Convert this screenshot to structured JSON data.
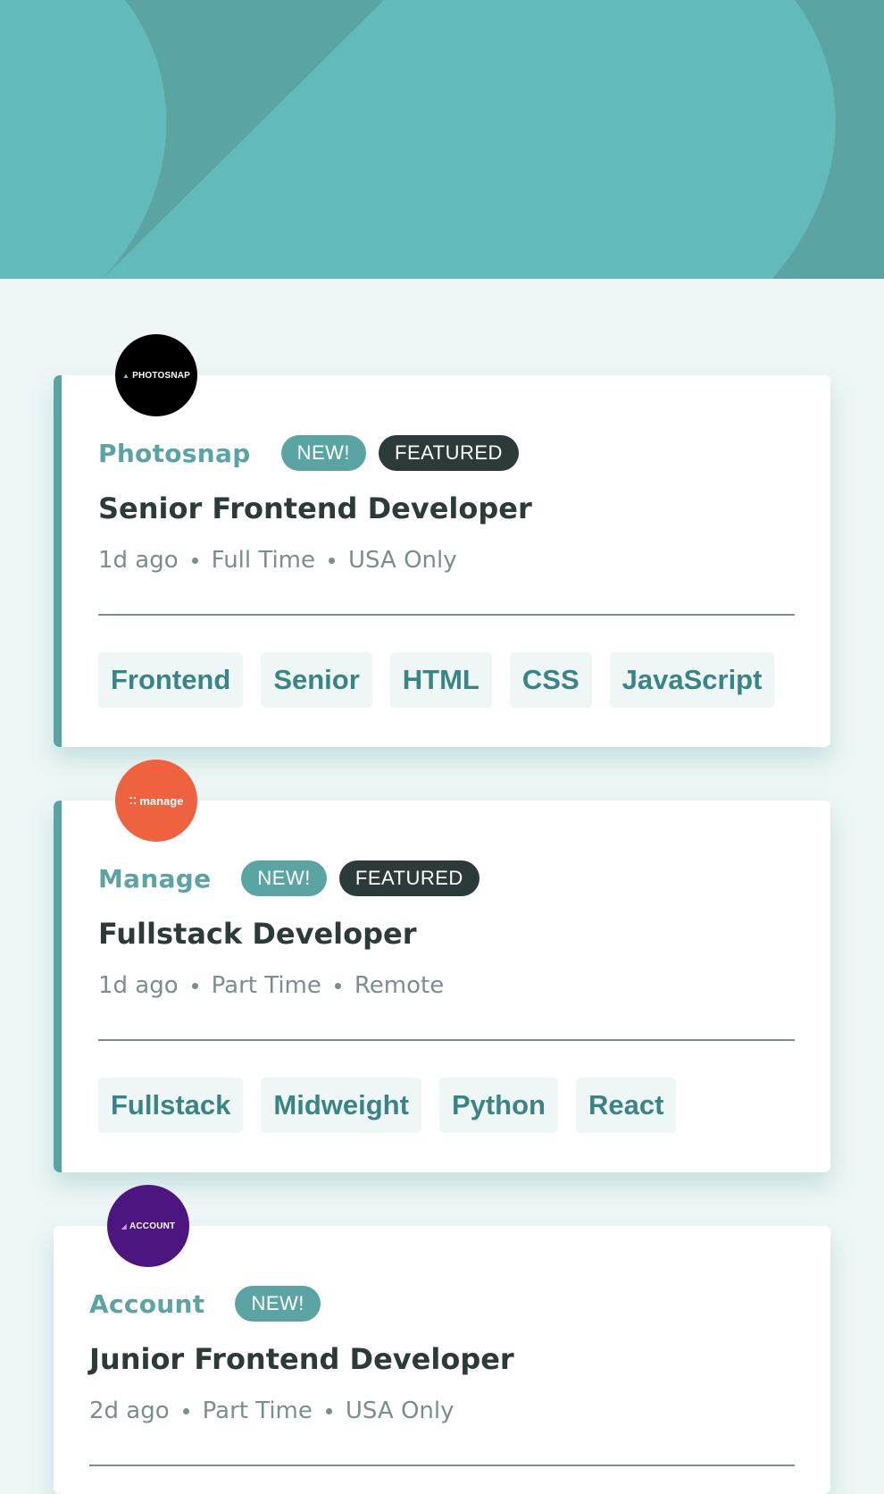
{
  "colors": {
    "header_bg": "#63baba",
    "header_shape": "#5ba4a4",
    "page_bg": "#eef6f6",
    "primary": "#5ba4a4",
    "dark": "#2c3a3a",
    "gray": "#7b8e8e",
    "tag_text": "#398585"
  },
  "jobs": [
    {
      "company": "Photosnap",
      "logo_text": "PHOTOSNAP",
      "logo_color": "#000000",
      "new_label": "NEW!",
      "featured_label": "FEATURED",
      "position": "Senior Frontend Developer",
      "posted": "1d ago",
      "contract": "Full Time",
      "location": "USA Only",
      "tags": [
        "Frontend",
        "Senior",
        "HTML",
        "CSS",
        "JavaScript"
      ]
    },
    {
      "company": "Manage",
      "logo_text": "manage",
      "logo_color": "#ef6240",
      "new_label": "NEW!",
      "featured_label": "FEATURED",
      "position": "Fullstack Developer",
      "posted": "1d ago",
      "contract": "Part Time",
      "location": "Remote",
      "tags": [
        "Fullstack",
        "Midweight",
        "Python",
        "React"
      ]
    },
    {
      "company": "Account",
      "logo_text": "ACCOUNT",
      "logo_color": "#4c1580",
      "new_label": "NEW!",
      "position": "Junior Frontend Developer",
      "posted": "2d ago",
      "contract": "Part Time",
      "location": "USA Only"
    }
  ]
}
